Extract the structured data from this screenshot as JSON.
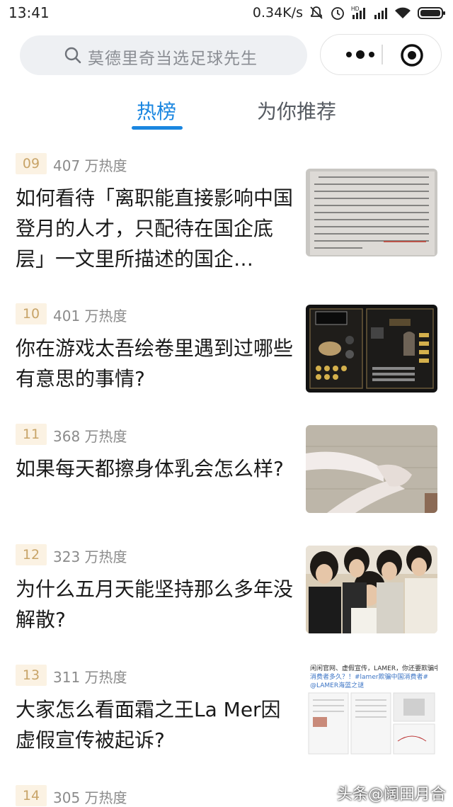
{
  "status_bar": {
    "time": "13:41",
    "speed": "0.34K/s",
    "icons": [
      "mute-icon",
      "alarm-icon",
      "hd-signal-icon",
      "signal-icon",
      "wifi-icon",
      "battery-icon"
    ]
  },
  "search": {
    "placeholder": "莫德里奇当选足球先生",
    "icon": "search-icon"
  },
  "capsule": {
    "more_icon": "more-dots-icon",
    "close_icon": "target-close-icon"
  },
  "tabs": [
    {
      "label": "热榜",
      "active": true
    },
    {
      "label": "为你推荐",
      "active": false
    }
  ],
  "colors": {
    "accent": "#1a86e0",
    "rank_bg": "#fbf2e3",
    "rank_text": "#c8a468",
    "heat_text": "#8b8b8b"
  },
  "items": [
    {
      "rank": "09",
      "heat": "407 万热度",
      "title": "如何看待「离职能直接影响中国登月的人才，只配待在国企底层」一文里所描述的国企…",
      "thumb": "document-scan-image"
    },
    {
      "rank": "10",
      "heat": "401 万热度",
      "title": "你在游戏太吾绘卷里遇到过哪些有意思的事情?",
      "thumb": "game-screenshot-image"
    },
    {
      "rank": "11",
      "heat": "368 万热度",
      "title": "如果每天都擦身体乳会怎么样?",
      "thumb": "legs-photo-image"
    },
    {
      "rank": "12",
      "heat": "323 万热度",
      "title": "为什么五月天能坚持那么多年没解散?",
      "thumb": "band-photo-image"
    },
    {
      "rank": "13",
      "heat": "311 万热度",
      "title": "大家怎么看面霜之王La Mer因虚假宣传被起诉?",
      "thumb": "weibo-screenshot-image",
      "thumb_text": {
        "line1": "闲闲官网、虚假宣传，LAMER，你还要欺骗中国",
        "line2": "消费者多久？！#lamer欺骗中国消费者#",
        "line3": "@LAMER海蓝之谜"
      }
    },
    {
      "rank": "14",
      "heat": "305 万热度"
    }
  ],
  "watermark": "头条@阔田月合"
}
